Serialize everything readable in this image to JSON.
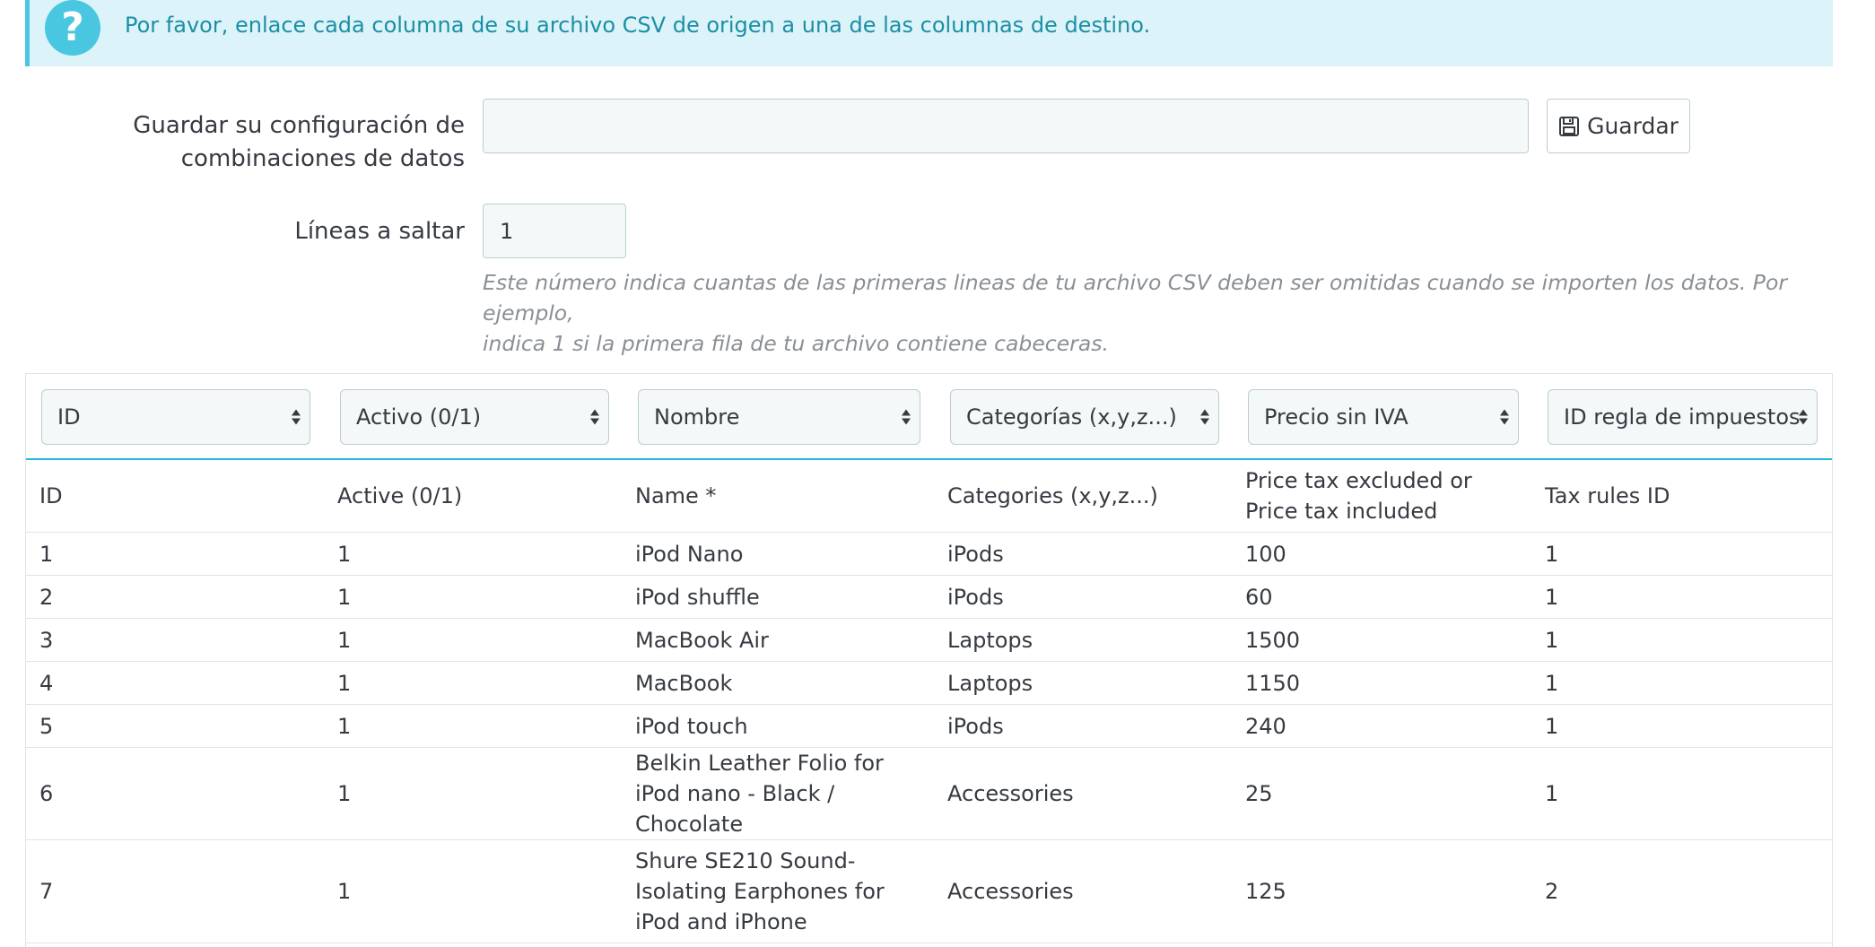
{
  "alert": {
    "icon": "question-icon",
    "glyph": "?",
    "text": "Por favor, enlace cada columna de su archivo CSV de origen a una de las columnas de destino."
  },
  "form": {
    "config_label_line1": "Guardar su configuración de",
    "config_label_line2": "combinaciones de datos",
    "config_value": "",
    "save_label": "Guardar",
    "skip_label": "Líneas a saltar",
    "skip_value": "1",
    "help_line1": "Este número indica cuantas de las primeras lineas de tu archivo CSV deben ser omitidas cuando se importen los datos. Por ejemplo,",
    "help_line2": "indica 1 si la primera fila de tu archivo contiene cabeceras."
  },
  "column_selects": [
    "ID",
    "Activo (0/1)",
    "Nombre",
    "Categorías (x,y,z...)",
    "Precio sin IVA",
    "ID regla de impuestos"
  ],
  "table": {
    "headers": [
      "ID",
      "Active (0/1)",
      "Name *",
      "Categories (x,y,z...)",
      "Price tax excluded or Price tax included",
      "Tax rules ID"
    ],
    "rows": [
      [
        "1",
        "1",
        "iPod Nano",
        "iPods",
        "100",
        "1"
      ],
      [
        "2",
        "1",
        "iPod shuffle",
        "iPods",
        "60",
        "1"
      ],
      [
        "3",
        "1",
        "MacBook Air",
        "Laptops",
        "1500",
        "1"
      ],
      [
        "4",
        "1",
        "MacBook",
        "Laptops",
        "1150",
        "1"
      ],
      [
        "5",
        "1",
        "iPod touch",
        "iPods",
        "240",
        "1"
      ],
      [
        "6",
        "1",
        "Belkin Leather Folio for iPod nano - Black / Chocolate",
        "Accessories",
        "25",
        "1"
      ],
      [
        "7",
        "1",
        "Shure SE210 Sound-Isolating Earphones for iPod and iPhone",
        "Accessories",
        "125",
        "2"
      ]
    ]
  },
  "colors": {
    "accent": "#25b9d7",
    "alert_bg": "#dcf3f9",
    "alert_text": "#1b8fa5",
    "border": "#bbcdd2"
  }
}
